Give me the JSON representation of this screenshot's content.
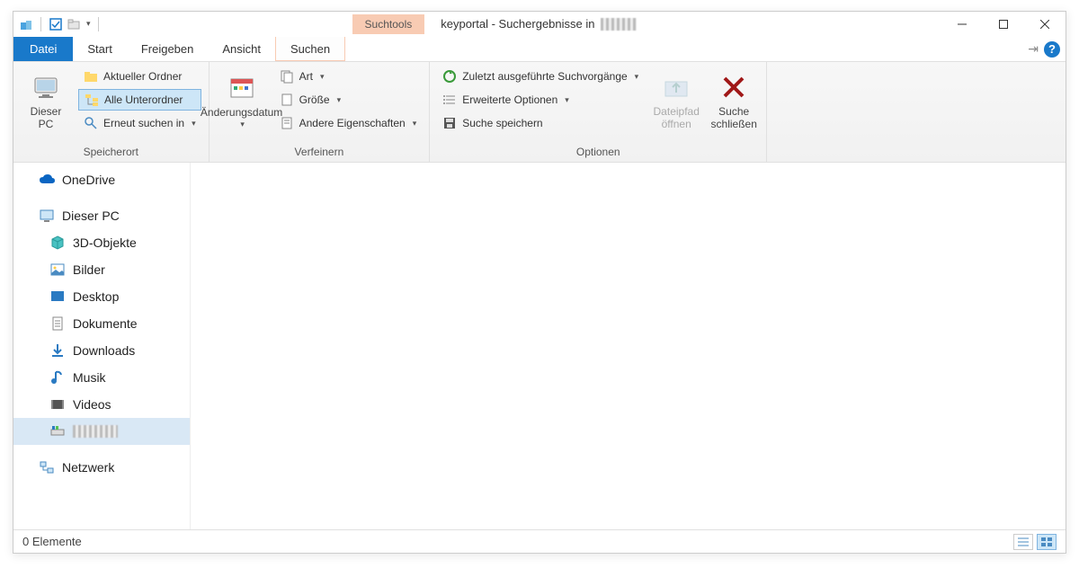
{
  "title_prefix": "keyportal - Suchergebnisse in",
  "contextual_tab_header": "Suchtools",
  "tabs": {
    "file": "Datei",
    "start": "Start",
    "share": "Freigeben",
    "view": "Ansicht",
    "search": "Suchen"
  },
  "ribbon": {
    "group_location": {
      "label": "Speicherort",
      "this_pc": "Dieser\nPC",
      "current_folder": "Aktueller Ordner",
      "all_subfolders": "Alle Unterordner",
      "search_again_in": "Erneut suchen in"
    },
    "group_refine": {
      "label": "Verfeinern",
      "date_modified": "Änderungsdatum",
      "kind": "Art",
      "size": "Größe",
      "other_props": "Andere Eigenschaften"
    },
    "group_options": {
      "label": "Optionen",
      "recent_searches": "Zuletzt ausgeführte Suchvorgänge",
      "advanced_options": "Erweiterte Optionen",
      "save_search": "Suche speichern",
      "open_file_location": "Dateipfad\nöffnen",
      "close_search": "Suche\nschließen"
    }
  },
  "nav": {
    "onedrive": "OneDrive",
    "this_pc": "Dieser PC",
    "objects3d": "3D-Objekte",
    "pictures": "Bilder",
    "desktop": "Desktop",
    "documents": "Dokumente",
    "downloads": "Downloads",
    "music": "Musik",
    "videos": "Videos",
    "network": "Netzwerk"
  },
  "statusbar": {
    "count": "0 Elemente"
  }
}
